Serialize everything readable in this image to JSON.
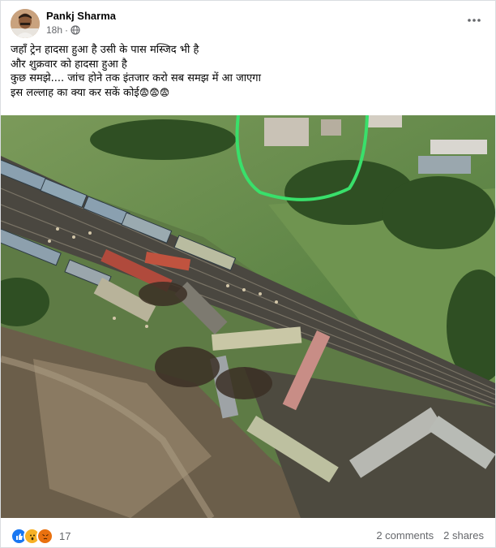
{
  "post": {
    "author": "Pankj Sharma",
    "time": "18h",
    "privacy_icon": "globe-icon",
    "menu_icon": "more-options-icon",
    "text_lines": [
      "जहाँ ट्रेन हादसा हुआ है उसी के पास मस्जिद भी है",
      "और शुक्रवार को हादसा हुआ है",
      "कुछ समझे.... जांच होने तक इंतजार करो सब समझ में आ जाएगा",
      "इस लल्लाह का क्या कर सकें कोई"
    ],
    "trailing_emoji": "😨😨😨",
    "image": {
      "description_icon": "aerial-train-accident-photo",
      "highlight_color": "#39e06b"
    }
  },
  "footer": {
    "reaction_icons": [
      "like-icon",
      "wow-icon",
      "angry-icon"
    ],
    "reaction_colors": [
      "#1877f2",
      "#f7b125",
      "#e9710f"
    ],
    "reaction_count": "17",
    "comments": "2 comments",
    "shares": "2 shares"
  }
}
